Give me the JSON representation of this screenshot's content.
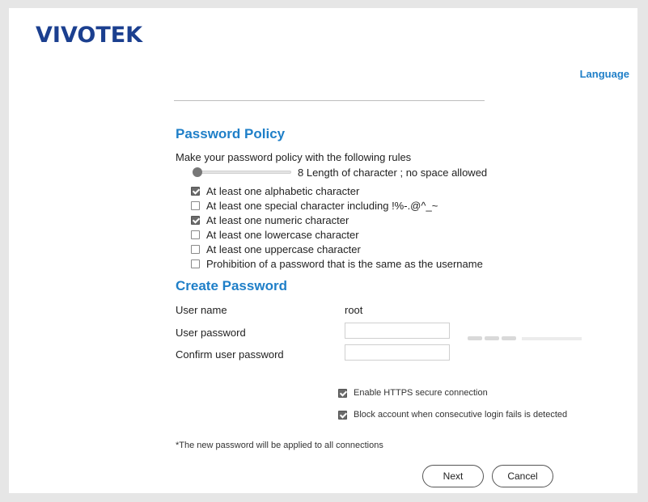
{
  "brand": {
    "logo": "VIVOTEK"
  },
  "header": {
    "language_link": "Language"
  },
  "policy": {
    "heading": "Password Policy",
    "intro": "Make your password policy with the following rules",
    "length_slider": {
      "value": 8,
      "label": "8 Length of character ; no space allowed"
    },
    "rules": [
      {
        "label": "At least one alphabetic character",
        "checked": true
      },
      {
        "label": "At least one special character including !%-.@^_~",
        "checked": false
      },
      {
        "label": "At least one numeric character",
        "checked": true
      },
      {
        "label": "At least one lowercase character",
        "checked": false
      },
      {
        "label": "At least one uppercase character",
        "checked": false
      },
      {
        "label": "Prohibition of a password that is the same as the username",
        "checked": false
      }
    ]
  },
  "create": {
    "heading": "Create Password",
    "username_label": "User name",
    "username_value": "root",
    "password_label": "User password",
    "password_value": "",
    "confirm_label": "Confirm user password",
    "confirm_value": ""
  },
  "options": {
    "https": {
      "label": "Enable HTTPS secure connection",
      "checked": true
    },
    "block": {
      "label": "Block account when consecutive login fails is detected",
      "checked": true
    }
  },
  "footnote": "*The new password will be applied to all connections",
  "buttons": {
    "next": "Next",
    "cancel": "Cancel"
  }
}
